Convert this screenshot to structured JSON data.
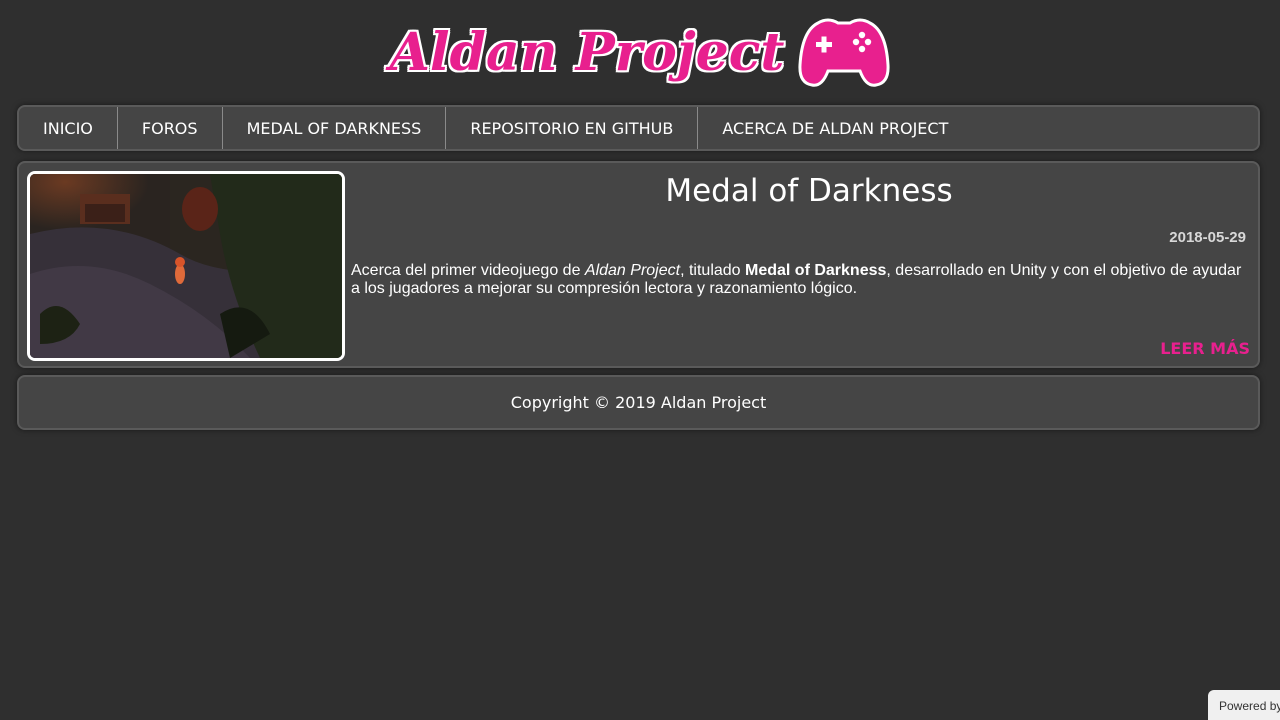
{
  "brand": {
    "logo_text": "Aldan Project",
    "logo_icon": "gamepad-icon",
    "accent_color": "#e8208e"
  },
  "nav": {
    "items": [
      {
        "label": "INICIO"
      },
      {
        "label": "FOROS"
      },
      {
        "label": "MEDAL OF DARKNESS"
      },
      {
        "label": "REPOSITORIO EN GITHUB"
      },
      {
        "label": "ACERCA DE ALDAN PROJECT"
      }
    ]
  },
  "post": {
    "title": "Medal of Darkness",
    "date": "2018-05-29",
    "desc_part1": "Acerca del primer videojuego de ",
    "desc_em": "Aldan Project",
    "desc_part2": ", titulado ",
    "desc_strong": "Medal of Darkness",
    "desc_part3": ", desarrollado en Unity y con el objetivo de ayudar a los jugadores a mejorar su compresión lectora y razonamiento lógico.",
    "read_more": "LEER MÁS"
  },
  "footer": {
    "copyright": "Copyright © 2019 Aldan Project"
  },
  "badge": {
    "label": "Powered by"
  }
}
